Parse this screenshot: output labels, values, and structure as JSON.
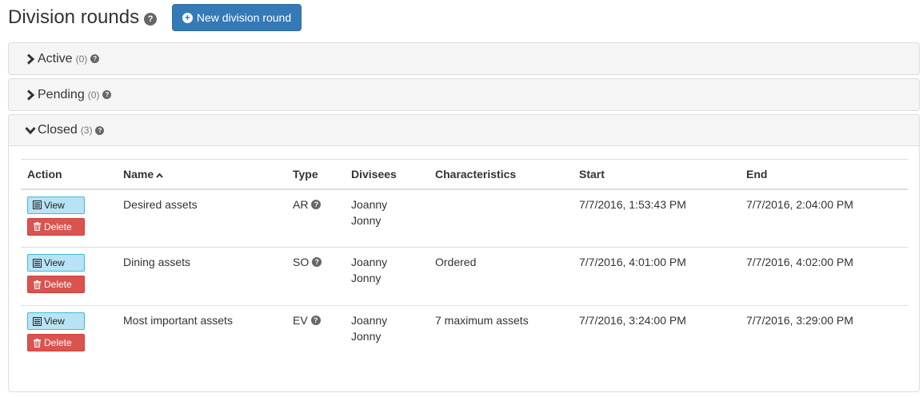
{
  "header": {
    "title": "Division rounds",
    "help_icon": "question-circle",
    "new_button_label": "New division round"
  },
  "panels": {
    "active": {
      "label": "Active",
      "count": "(0)",
      "expanded": false
    },
    "pending": {
      "label": "Pending",
      "count": "(0)",
      "expanded": false
    },
    "closed": {
      "label": "Closed",
      "count": "(3)",
      "expanded": true
    }
  },
  "table": {
    "columns": {
      "action": "Action",
      "name": "Name",
      "type": "Type",
      "divisees": "Divisees",
      "characteristics": "Characteristics",
      "start": "Start",
      "end": "End"
    },
    "sort": {
      "column": "name",
      "direction": "ascending"
    },
    "view_label": "View",
    "delete_label": "Delete",
    "rows": [
      {
        "name": "Desired assets",
        "type": "AR",
        "divisee1": "Joanny",
        "divisee2": "Jonny",
        "characteristics": "",
        "start": "7/7/2016, 1:53:43 PM",
        "end": "7/7/2016, 2:04:00 PM"
      },
      {
        "name": "Dining assets",
        "type": "SO",
        "divisee1": "Joanny",
        "divisee2": "Jonny",
        "characteristics": "Ordered",
        "start": "7/7/2016, 4:01:00 PM",
        "end": "7/7/2016, 4:02:00 PM"
      },
      {
        "name": "Most important assets",
        "type": "EV",
        "divisee1": "Joanny",
        "divisee2": "Jonny",
        "characteristics": "7 maximum assets",
        "start": "7/7/2016, 3:24:00 PM",
        "end": "7/7/2016, 3:29:00 PM"
      }
    ]
  },
  "colors": {
    "primary": "#337ab7",
    "info_light": "#b8e3f5",
    "danger": "#d9534f",
    "panel_heading": "#f5f5f5"
  }
}
